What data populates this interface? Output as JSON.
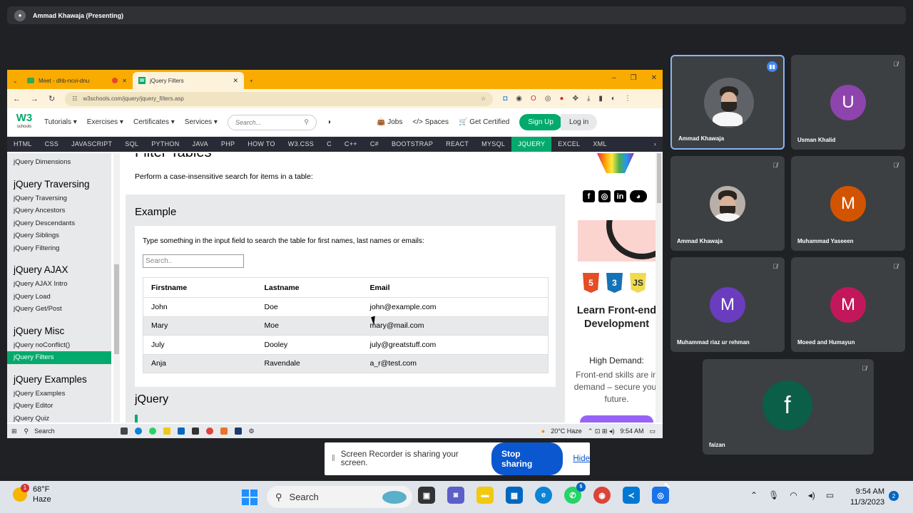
{
  "meet": {
    "presenter_label": "Ammad Khawaja (Presenting)",
    "participants": [
      {
        "name": "Ammad Khawaja",
        "initial": "",
        "color": "",
        "speaking": true
      },
      {
        "name": "Usman Khalid",
        "initial": "U",
        "color": "#8e44ad",
        "speaking": false
      },
      {
        "name": "Ammad Khawaja",
        "initial": "",
        "color": "",
        "speaking": false
      },
      {
        "name": "Muhammad Yaseeen",
        "initial": "M",
        "color": "#d35400",
        "speaking": false
      },
      {
        "name": "Muhammad riaz ur rehman",
        "initial": "M",
        "color": "#6a3dbf",
        "speaking": false
      },
      {
        "name": "Moeed and Humayun",
        "initial": "M",
        "color": "#c2185b",
        "speaking": false
      },
      {
        "name": "faizan",
        "initial": "f",
        "color": "#0b5e47",
        "speaking": false
      }
    ]
  },
  "browser": {
    "tabs": [
      {
        "label": "Meet - dhb-ncvi-dnu"
      },
      {
        "label": "jQuery Filters"
      }
    ],
    "new_tab": "+",
    "url": "w3schools.com/jquery/jquery_filters.asp"
  },
  "w3": {
    "logo_text": "W3",
    "logo_sub": "schools",
    "menu": [
      "Tutorials",
      "Exercises",
      "Certificates",
      "Services"
    ],
    "search_placeholder": "Search...",
    "links": [
      "Jobs",
      "Spaces",
      "Get Certified"
    ],
    "signup": "Sign Up",
    "login": "Log in",
    "topnav": [
      "HTML",
      "CSS",
      "JAVASCRIPT",
      "SQL",
      "PYTHON",
      "JAVA",
      "PHP",
      "HOW TO",
      "W3.CSS",
      "C",
      "C++",
      "C#",
      "BOOTSTRAP",
      "REACT",
      "MYSQL",
      "JQUERY",
      "EXCEL",
      "XML"
    ],
    "topnav_active": "JQUERY"
  },
  "sidebar": {
    "sections": [
      {
        "heading": "",
        "items": [
          "jQuery Dimensions"
        ]
      },
      {
        "heading": "jQuery Traversing",
        "items": [
          "jQuery Traversing",
          "jQuery Ancestors",
          "jQuery Descendants",
          "jQuery Siblings",
          "jQuery Filtering"
        ]
      },
      {
        "heading": "jQuery AJAX",
        "items": [
          "jQuery AJAX Intro",
          "jQuery Load",
          "jQuery Get/Post"
        ]
      },
      {
        "heading": "jQuery Misc",
        "items": [
          "jQuery noConflict()",
          "jQuery Filters"
        ]
      },
      {
        "heading": "jQuery Examples",
        "items": [
          "jQuery Examples",
          "jQuery Editor",
          "jQuery Quiz"
        ]
      }
    ],
    "selected": "jQuery Filters"
  },
  "main": {
    "title": "Filter Tables",
    "intro": "Perform a case-insensitive search for items in a table:",
    "example_heading": "Example",
    "example_desc": "Type something in the input field to search the table for first names, last names or emails:",
    "search_placeholder": "Search..",
    "table": {
      "headers": [
        "Firstname",
        "Lastname",
        "Email"
      ],
      "rows": [
        [
          "John",
          "Doe",
          "john@example.com"
        ],
        [
          "Mary",
          "Moe",
          "mary@mail.com"
        ],
        [
          "July",
          "Dooley",
          "july@greatstuff.com"
        ],
        [
          "Anja",
          "Ravendale",
          "a_r@test.com"
        ]
      ]
    },
    "next_heading": "jQuery"
  },
  "ads": {
    "learn": "Learn Front-end Development",
    "high_demand": "High Demand:",
    "fe_text": "Front-end skills are in demand – secure your future.",
    "badges": [
      "5",
      "3",
      "JS"
    ]
  },
  "inner_taskbar": {
    "search": "Search",
    "weather": "20°C Haze",
    "time": "9:54 AM"
  },
  "share_bar": {
    "text": "Screen Recorder is sharing your screen.",
    "stop": "Stop sharing",
    "hide": "Hide"
  },
  "taskbar": {
    "temp": "68°F",
    "condition": "Haze",
    "weather_badge": "1",
    "search": "Search",
    "whatsapp_badge": "5",
    "time": "9:54 AM",
    "date": "11/3/2023",
    "notifications": "2"
  }
}
